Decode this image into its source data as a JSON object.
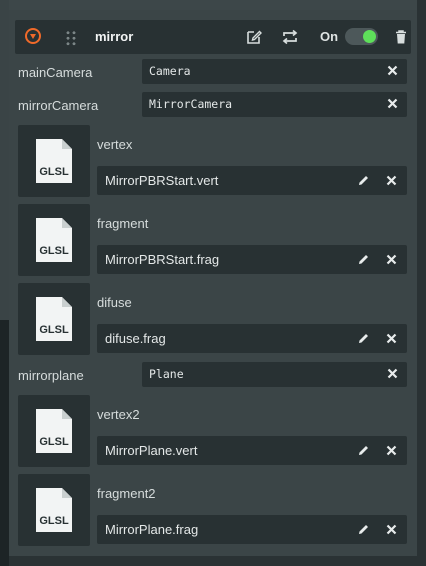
{
  "component": {
    "name": "mirror",
    "toggle_label": "On",
    "toggle_on": true,
    "accent_color": "#f06a2a",
    "toggle_color": "#5ee05a"
  },
  "fields": {
    "mainCamera": {
      "label": "mainCamera",
      "value": "Camera"
    },
    "mirrorCamera": {
      "label": "mirrorCamera",
      "value": "MirrorCamera"
    },
    "mirrorplane": {
      "label": "mirrorplane",
      "value": "Plane"
    }
  },
  "shaders": [
    {
      "label": "vertex",
      "file": "MirrorPBRStart.vert",
      "thumb_text": "GLSL"
    },
    {
      "label": "fragment",
      "file": "MirrorPBRStart.frag",
      "thumb_text": "GLSL"
    },
    {
      "label": "difuse",
      "file": "difuse.frag",
      "thumb_text": "GLSL"
    },
    {
      "label": "vertex2",
      "file": "MirrorPlane.vert",
      "thumb_text": "GLSL"
    },
    {
      "label": "fragment2",
      "file": "MirrorPlane.frag",
      "thumb_text": "GLSL"
    }
  ],
  "icons": {
    "collapse": "collapse-circle-icon",
    "drag": "drag-handle-icon",
    "edit_component": "edit-icon",
    "replace": "swap-icon",
    "delete": "trash-icon",
    "clear": "close-icon",
    "edit_file": "pencil-icon",
    "file_thumb": "glsl-file-icon"
  }
}
